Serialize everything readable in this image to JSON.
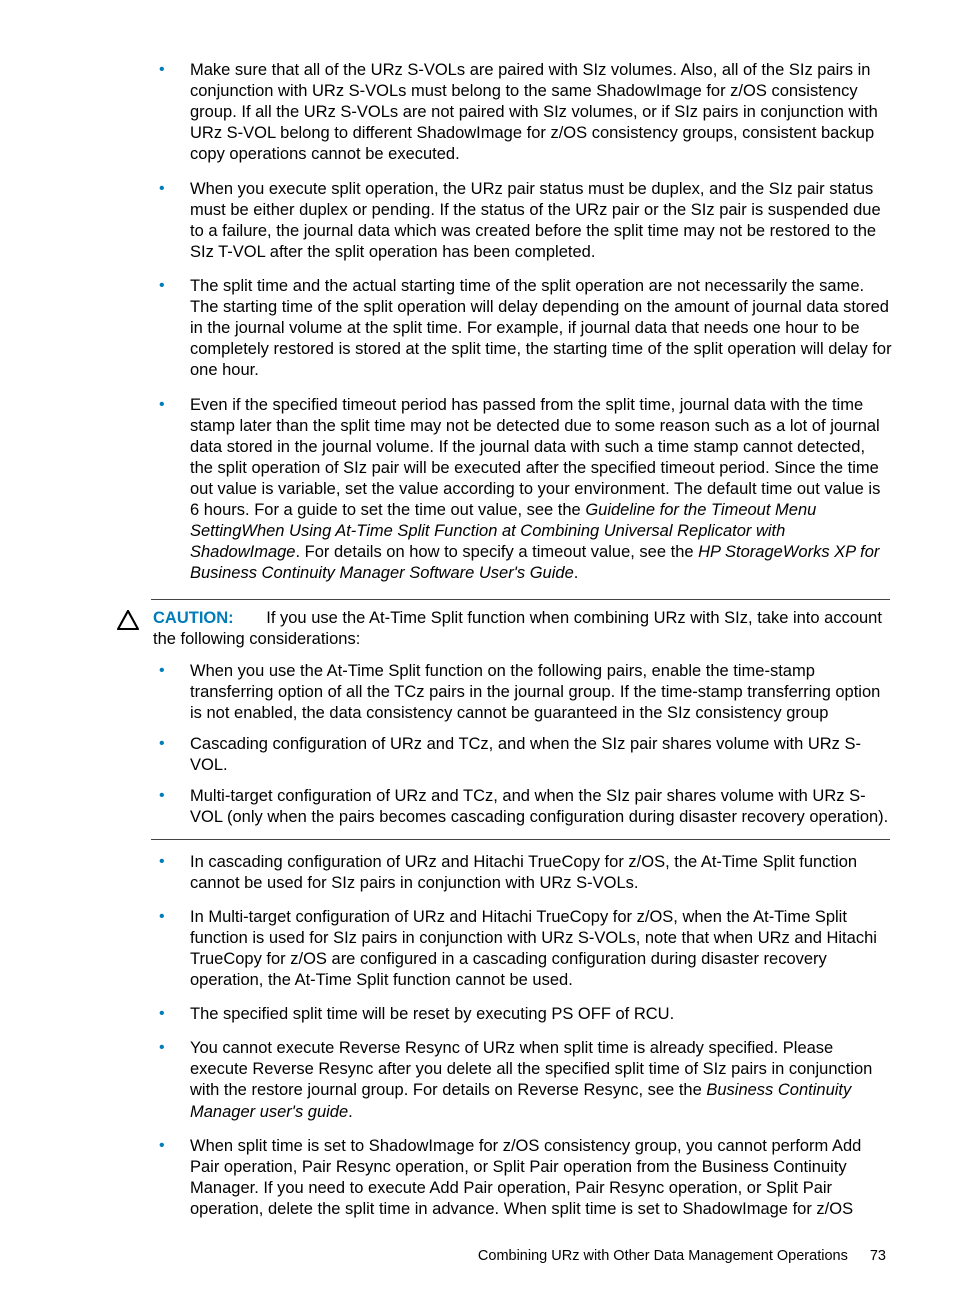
{
  "topBullets": [
    {
      "text": "Make sure that all of the URz S-VOLs are paired with SIz volumes. Also, all of the SIz pairs in conjunction with URz S-VOLs must belong to the same ShadowImage for z/OS consistency group. If all the URz S-VOLs are not paired with SIz volumes, or if SIz pairs in conjunction with URz S-VOL belong to different ShadowImage for z/OS consistency groups, consistent backup copy operations cannot be executed."
    },
    {
      "text": "When you execute split operation, the URz pair status must be duplex, and the SIz pair status must be either duplex or pending. If the status of the URz pair or the SIz pair is suspended due to a failure, the journal data which was created before the split time may not be restored to the SIz T-VOL after the split operation has been completed."
    },
    {
      "text": "The split time and the actual starting time of the split operation are not necessarily the same. The starting time of the split operation will delay depending on the amount of journal data stored in the journal volume at the split time. For example, if journal data that needs one hour to be completely restored is stored at the split time, the starting time of the split operation will delay for one hour."
    },
    {
      "html": "Even if the specified timeout period has passed from the split time, journal data with the time stamp later than the split time may not be detected due to some reason such as a lot of journal data stored in the journal volume. If the journal data with such a time stamp cannot detected, the split operation of SIz pair will be executed after the specified timeout period. Since the time out value is variable, set the value according to your environment. The default time out value is 6 hours. For a guide to set the time out value, see the <span class=\"italic\">Guideline for the Timeout Menu SettingWhen Using At-Time Split Function at Combining Universal Replicator with ShadowImage</span>. For details on how to specify a timeout value, see the <span class=\"italic\">HP StorageWorks XP for Business Continuity Manager Software User's Guide</span>."
    }
  ],
  "caution": {
    "label": "CAUTION:",
    "intro": "If you use the At-Time Split function when combining URz with SIz, take into account the following considerations:",
    "bullets": [
      "When you use the At-Time Split function on the following pairs, enable the time-stamp transferring option of all the TCz pairs in the journal group. If the time-stamp transferring option is not enabled, the data consistency cannot be guaranteed in the SIz consistency group",
      "Cascading configuration of URz and TCz, and when the SIz pair shares volume with URz S-VOL.",
      "Multi-target configuration of URz and TCz, and when the SIz pair shares volume with URz S-VOL (only when the pairs becomes cascading configuration during disaster recovery operation)."
    ]
  },
  "bottomBullets": [
    {
      "text": "In cascading configuration of URz and Hitachi TrueCopy for z/OS, the At-Time Split function cannot be used for SIz pairs in conjunction with URz S-VOLs."
    },
    {
      "text": "In Multi-target configuration of URz and Hitachi TrueCopy for z/OS, when the At-Time Split function is used for SIz pairs in conjunction with URz S-VOLs, note that when URz and Hitachi TrueCopy for z/OS are configured in a cascading configuration during disaster recovery operation, the At-Time Split function cannot be used."
    },
    {
      "text": "The specified split time will be reset by executing PS OFF of RCU."
    },
    {
      "html": "You cannot execute Reverse Resync of URz when split time is already specified. Please execute Reverse Resync after you delete all the specified split time of SIz pairs in conjunction with the restore journal group. For details on Reverse Resync, see the <span class=\"italic\">Business Continuity Manager user's guide</span>."
    },
    {
      "text": "When split time is set to ShadowImage for z/OS consistency group, you cannot perform Add Pair operation, Pair Resync operation, or Split Pair operation from the Business Continuity Manager. If you need to execute Add Pair operation, Pair Resync operation, or Split Pair operation, delete the split time in advance. When split time is set to ShadowImage for z/OS"
    }
  ],
  "footer": {
    "label": "Combining URz with Other Data Management Operations",
    "page": "73"
  }
}
